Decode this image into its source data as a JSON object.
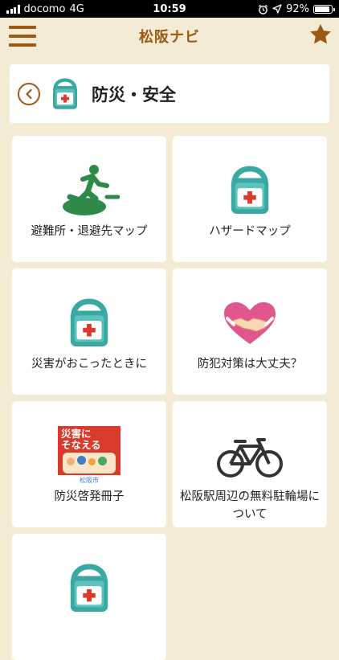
{
  "status_bar": {
    "carrier": "docomo",
    "network": "4G",
    "time": "10:59",
    "battery": "92%"
  },
  "nav": {
    "title": "松阪ナビ",
    "accent": "#9a5a14",
    "star_color": "#9a5a14"
  },
  "header": {
    "title": "防災・安全",
    "icon": "first-aid-backpack-icon"
  },
  "tiles": [
    {
      "label": "避難所・退避先マップ",
      "icon": "emergency-exit-icon"
    },
    {
      "label": "ハザードマップ",
      "icon": "first-aid-backpack-icon"
    },
    {
      "label": "災害がおこったときに",
      "icon": "first-aid-backpack-icon"
    },
    {
      "label": "防犯対策は大丈夫？",
      "icon": "heart-handshake-icon"
    },
    {
      "label": "防災啓発冊子",
      "icon": "disaster-booklet-icon",
      "booklet_title": "災害に\nそなえる",
      "booklet_publisher": "松阪市"
    },
    {
      "label": "松阪駅周辺の無料駐輪場について",
      "icon": "bicycle-icon"
    },
    {
      "label": "",
      "icon": "first-aid-backpack-icon"
    }
  ],
  "colors": {
    "background": "#f3ebd3",
    "teal": "#3aa9a3",
    "exit_green": "#2f8a4a",
    "red": "#d93a2b"
  }
}
